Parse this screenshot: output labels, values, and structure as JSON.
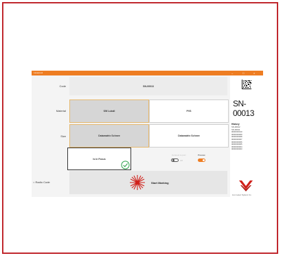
{
  "window": {
    "title": "Laserpool"
  },
  "labels": {
    "code": "Code",
    "material": "Material",
    "size": "Size"
  },
  "code_value": "SN-00013",
  "material": {
    "option1": "SW Lukall",
    "option2": "PVS"
  },
  "size": {
    "option1": "Datamatrix Schnee",
    "option2": "Datamatrix Schnee"
  },
  "focus_button": "Is in Focus",
  "toggles": {
    "left_label": "Connect to port",
    "left_state": "Off",
    "right_label": "Preview"
  },
  "radio_code": "Radio Code",
  "start_marking": "Start Marking",
  "preview_code": "SN-00013",
  "history": {
    "title": "History",
    "items": [
      "SN-00012",
      "SN-00011",
      "0000000010",
      "0000000009",
      "0000000008",
      "0000000007",
      "0000000006",
      "0000000005",
      "0000000004",
      "0000000003"
    ]
  },
  "logo_text": "Lion Laser System Co",
  "colors": {
    "accent": "#ee7d22",
    "frame": "#c0272d",
    "laser": "#d0201a",
    "check": "#2fa34d"
  }
}
